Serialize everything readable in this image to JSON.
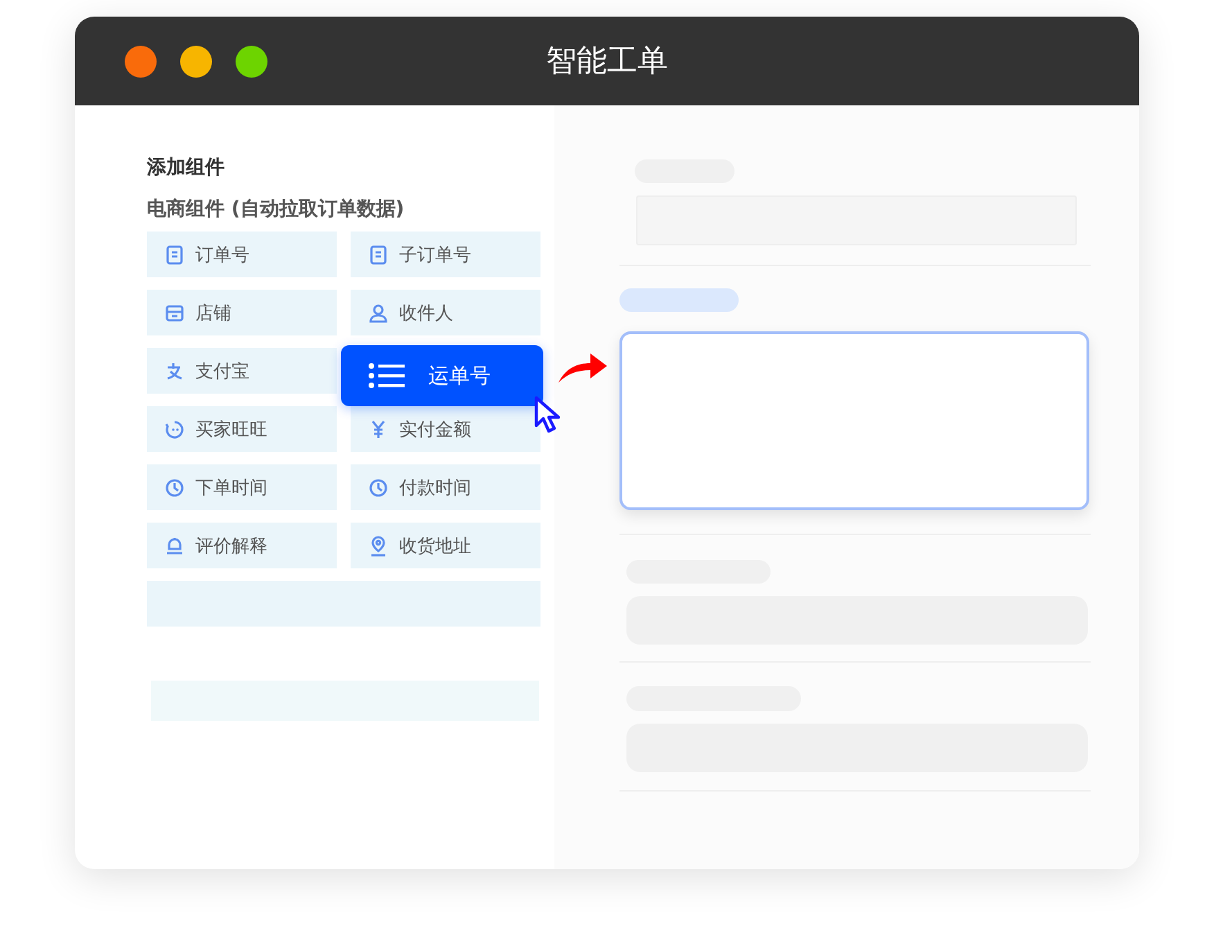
{
  "window": {
    "title": "智能工单",
    "controls": [
      {
        "color": "#f96b0b"
      },
      {
        "color": "#f7b500"
      },
      {
        "color": "#6dd400"
      }
    ]
  },
  "components_panel": {
    "heading": "添加组件",
    "subheading": "电商组件 (自动拉取订单数据)",
    "items": [
      {
        "label": "订单号"
      },
      {
        "label": "子订单号"
      },
      {
        "label": "店铺"
      },
      {
        "label": "收件人"
      },
      {
        "label": "支付宝"
      },
      {
        "label": "运单号",
        "kind": "dragged"
      },
      {
        "label": "买家旺旺"
      },
      {
        "label": "实付金额"
      },
      {
        "label": "下单时间"
      },
      {
        "label": "付款时间"
      },
      {
        "label": "评价解释"
      },
      {
        "label": "收货地址"
      }
    ]
  }
}
